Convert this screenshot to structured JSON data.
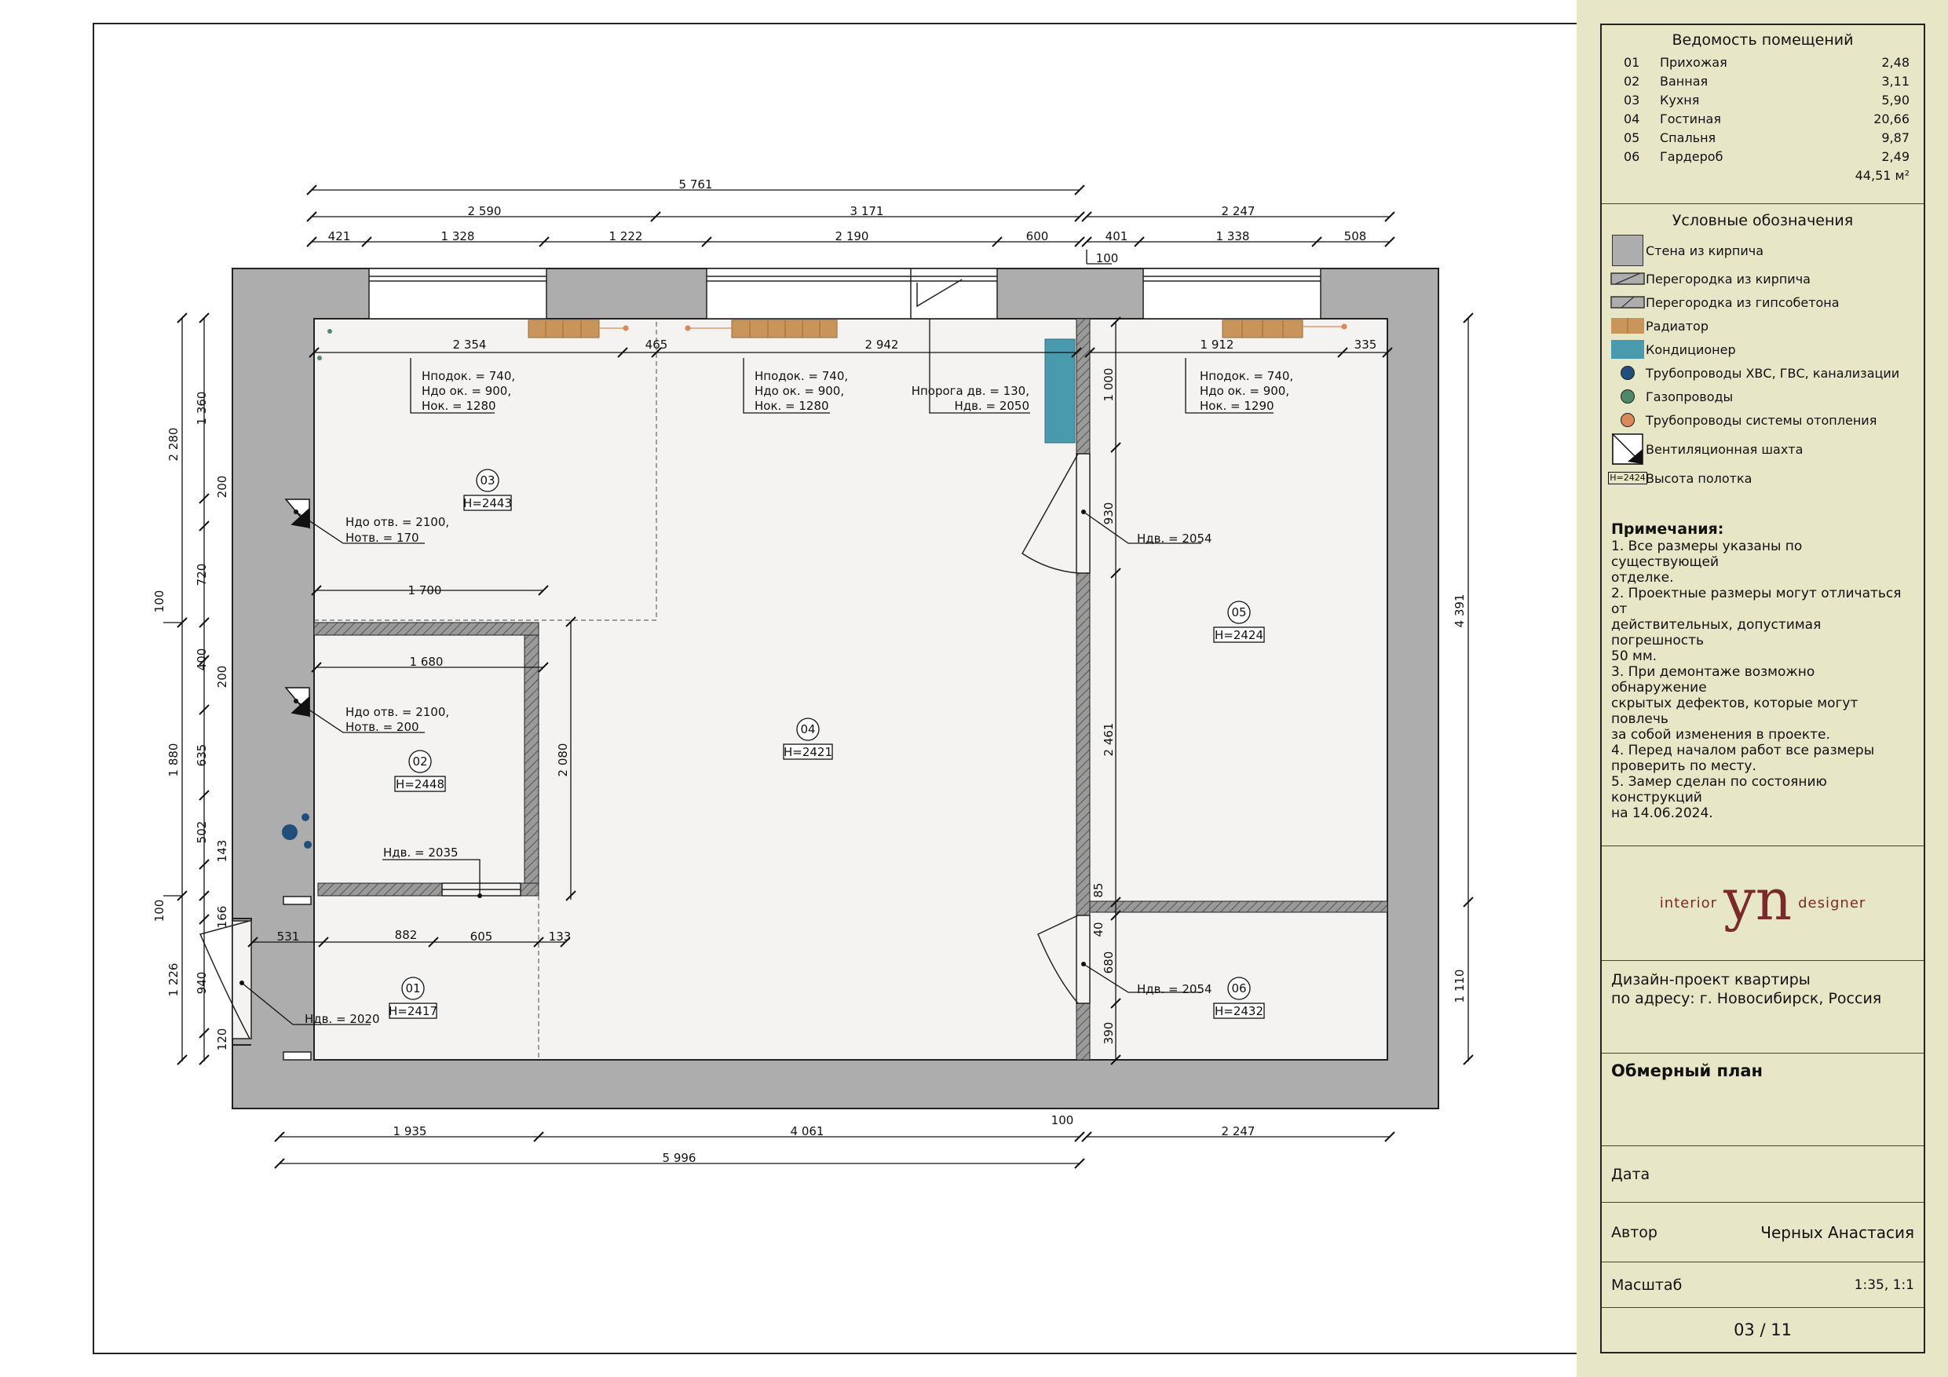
{
  "rooms_table": {
    "title": "Ведомость помещений",
    "rows": [
      {
        "num": "01",
        "name": "Прихожая",
        "area": "2,48"
      },
      {
        "num": "02",
        "name": "Ванная",
        "area": "3,11"
      },
      {
        "num": "03",
        "name": "Кухня",
        "area": "5,90"
      },
      {
        "num": "04",
        "name": "Гостиная",
        "area": "20,66"
      },
      {
        "num": "05",
        "name": "Спальня",
        "area": "9,87"
      },
      {
        "num": "06",
        "name": "Гардероб",
        "area": "2,49"
      }
    ],
    "total": "44,51 м²"
  },
  "legend": {
    "title": "Условные обозначения",
    "items": [
      {
        "id": "brick-wall",
        "label": "Стена из кирпича",
        "color": "#adadad"
      },
      {
        "id": "brick-partition",
        "label": "Перегородка из кирпича",
        "color": "#adadad"
      },
      {
        "id": "gypsum-partition",
        "label": "Перегородка из гипсобетона",
        "color": "#adadad"
      },
      {
        "id": "radiator",
        "label": "Радиатор",
        "color": "#c9955a"
      },
      {
        "id": "air-conditioner",
        "label": "Кондиционер",
        "color": "#4a9aad"
      },
      {
        "id": "water-pipes",
        "label": "Трубопроводы ХВС, ГВС, канализации",
        "color": "#1f4f7a"
      },
      {
        "id": "gas-pipes",
        "label": "Газопроводы",
        "color": "#4e8a6a"
      },
      {
        "id": "heating-pipes",
        "label": "Трубопроводы системы отопления",
        "color": "#d98a5a"
      },
      {
        "id": "vent-shaft",
        "label": "Вентиляционная шахта",
        "color": "#111111"
      },
      {
        "id": "ceiling-height",
        "label": "Высота полотка",
        "tag": "H=2424"
      }
    ]
  },
  "notes": {
    "heading": "Примечания:",
    "lines": [
      "1. Все размеры указаны по существующей",
      "отделке.",
      "2. Проектные размеры могут отличаться от",
      "действительных, допустимая погрешность",
      "50 мм.",
      "3. При демонтаже возможно обнаружение",
      "скрытых дефектов, которые могут повлечь",
      "за собой изменения в проекте.",
      "4. Перед началом работ все размеры",
      "проверить по месту.",
      "5. Замер сделан по состоянию конструкций",
      "на 14.06.2024."
    ]
  },
  "logo": {
    "left": "interior",
    "mark": "yn",
    "right": "designer",
    "color": "#7a2a2a"
  },
  "project": {
    "line1": "Дизайн-проект квартиры",
    "line2": "по адресу: г. Новосибирск, Россия"
  },
  "sheet_title": "Обмерный план",
  "fields": {
    "date_label": "Дата",
    "date_value": "",
    "author_label": "Автор",
    "author_value": "Черных Анастасия",
    "scale_label": "Масштаб",
    "scale_value": "1:35, 1:1",
    "page": "03 / 11"
  },
  "plan": {
    "top_dims": {
      "overall": "5 761",
      "row2": [
        "2 590",
        "3 171",
        "2 247"
      ],
      "row3": [
        "421",
        "1 328",
        "1 222",
        "2 190",
        "600",
        "401",
        "1 338",
        "508"
      ],
      "wall": "100"
    },
    "inner_top_dims": [
      "2 354",
      "465",
      "2 942",
      "1 912",
      "335"
    ],
    "bottom_dims": {
      "row1": [
        "1 935",
        "4 061",
        "100",
        "2 247"
      ],
      "overall": "5 996"
    },
    "left_dims": {
      "outer": [
        "2 280",
        "100",
        "1 880",
        "100",
        "1 226"
      ],
      "inner": [
        "1 360",
        "200",
        "720",
        "400",
        "200",
        "635",
        "502",
        "143",
        "166",
        "940",
        "120"
      ]
    },
    "right_dims": [
      "4 391",
      "1 110"
    ],
    "interior_dims": [
      "1 700",
      "1 680",
      "2 080",
      "531",
      "882",
      "605",
      "133",
      "1 000",
      "930",
      "2 461",
      "85",
      "40",
      "680",
      "390"
    ],
    "window_notes": [
      [
        "Hподок. = 740,",
        "Hдо ок. = 900,",
        "Hок. = 1280"
      ],
      [
        "Hподок. = 740,",
        "Hдо ок. = 900,",
        "Hок. = 1280"
      ],
      [
        "Hпорога дв. = 130,",
        "Hдв. = 2050"
      ],
      [
        "Hподок. = 740,",
        "Hдо ок. = 900,",
        "Hок. = 1290"
      ]
    ],
    "vent_notes": [
      [
        "Hдо отв. = 2100,",
        "Hотв. = 170"
      ],
      [
        "Hдо отв. = 2100,",
        "Hотв. = 200"
      ]
    ],
    "door_notes": [
      "Hдв. = 2054",
      "Hдв. = 2054",
      "Hдв. = 2035",
      "Hдв. = 2020"
    ],
    "room_tags": [
      {
        "num": "03",
        "h": "H=2443"
      },
      {
        "num": "02",
        "h": "H=2448"
      },
      {
        "num": "04",
        "h": "H=2421"
      },
      {
        "num": "05",
        "h": "H=2424"
      },
      {
        "num": "06",
        "h": "H=2432"
      },
      {
        "num": "01",
        "h": "H=2417"
      }
    ]
  }
}
